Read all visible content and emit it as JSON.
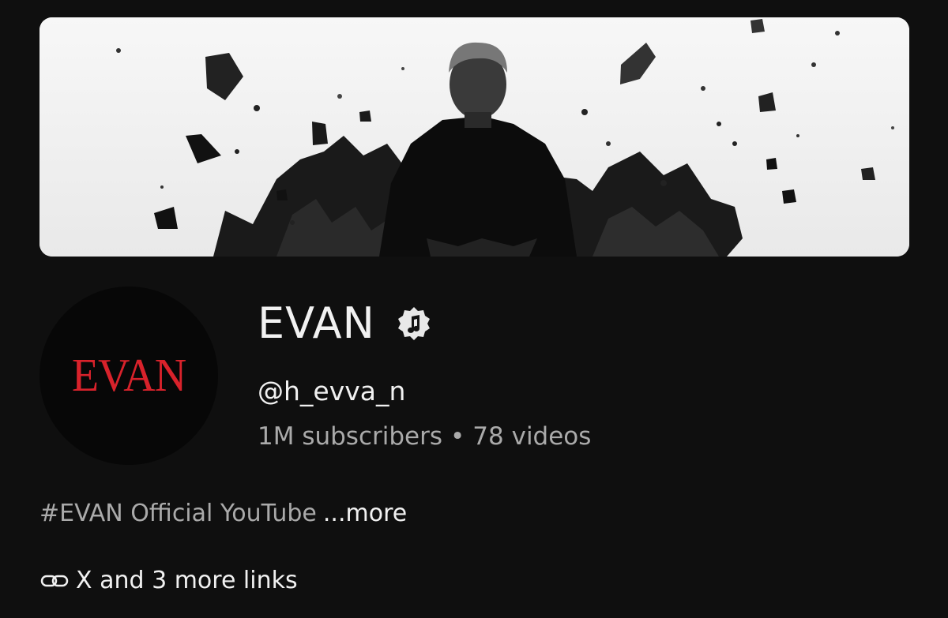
{
  "channel": {
    "name": "EVAN",
    "handle": "@h_evva_n",
    "subscribers": "1M subscribers",
    "separator": "•",
    "videos": "78 videos",
    "avatar_text": "EVAN",
    "verified_icon": "music-note-verified-icon"
  },
  "description": {
    "text": "#EVAN Official YouTube",
    "more_label": "...more"
  },
  "links": {
    "label": "X and 3 more links",
    "icon": "link-icon"
  },
  "colors": {
    "background": "#0f0f0f",
    "text_primary": "#f1f1f1",
    "text_secondary": "#aaaaaa",
    "avatar_text": "#d8222b"
  }
}
